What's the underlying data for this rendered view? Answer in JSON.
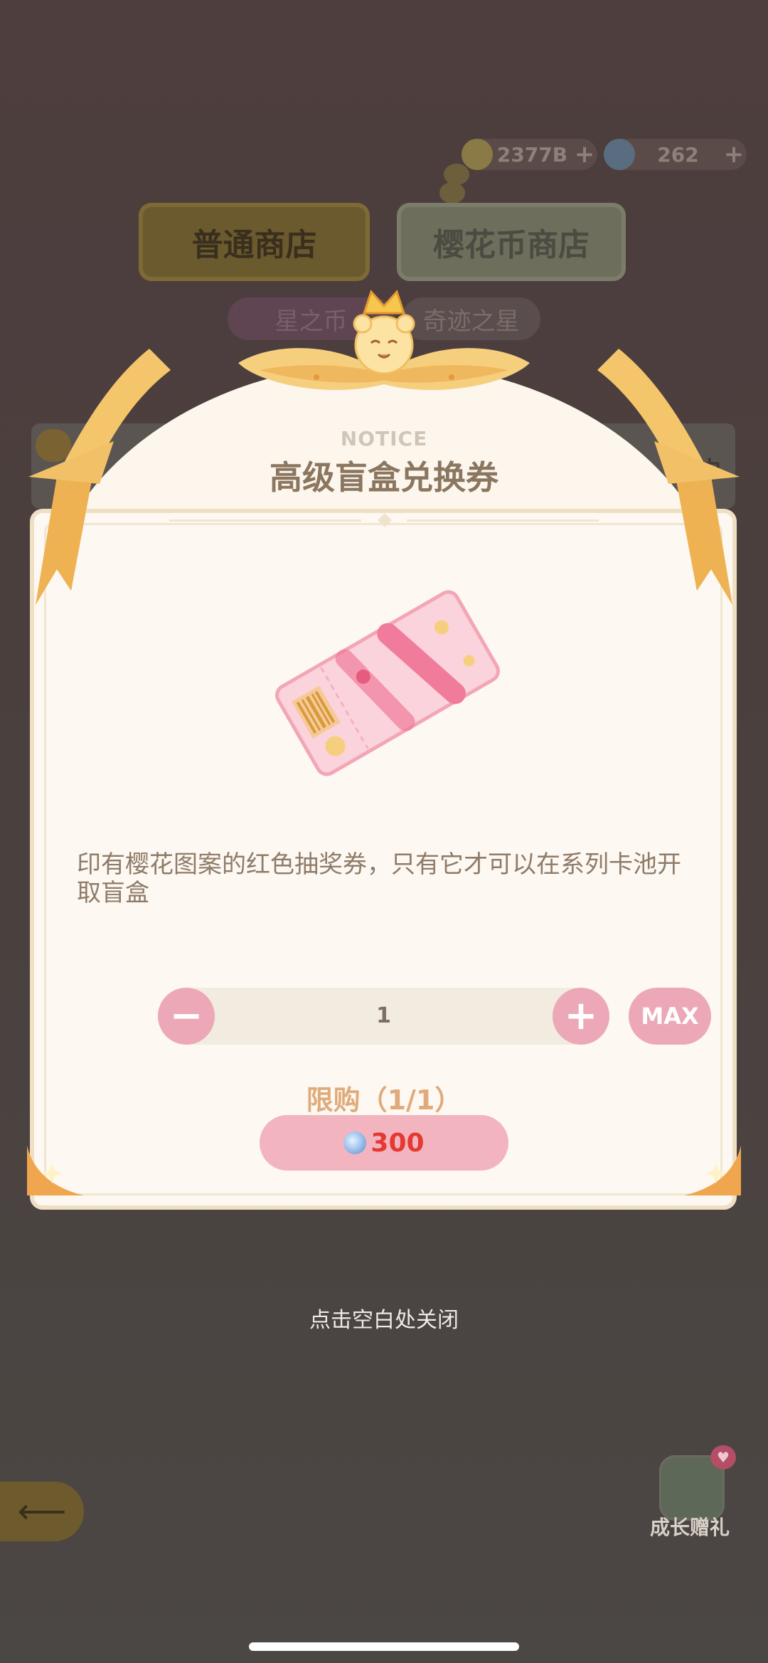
{
  "currencies": {
    "gold_value": "2377B",
    "gem_value": "262",
    "plus_symbol": "+"
  },
  "shop_tabs": {
    "normal": "普通商店",
    "sakura": "樱花币商店"
  },
  "sub_tabs": {
    "star_coin": "星之币",
    "miracle_star": "奇迹之星"
  },
  "bg_card_text": "是·中",
  "dialog": {
    "notice": "NOTICE",
    "title": "高级盲盒兑换券",
    "description": "印有樱花图案的红色抽奖券，只有它才可以在系列卡池开取盲盒",
    "quantity": "1",
    "minus_symbol": "−",
    "plus_symbol": "+",
    "max_label": "MAX",
    "limit_text": "限购（1/1）",
    "price": "300"
  },
  "close_hint": "点击空白处关闭",
  "growth_gift_label": "成长赠礼",
  "back_symbol": "⟵",
  "colors": {
    "accent_pink": "#eca8b6",
    "price_red": "#e43a32",
    "title_brown": "#8b7660",
    "ribbon_gold": "#f4c56a"
  }
}
